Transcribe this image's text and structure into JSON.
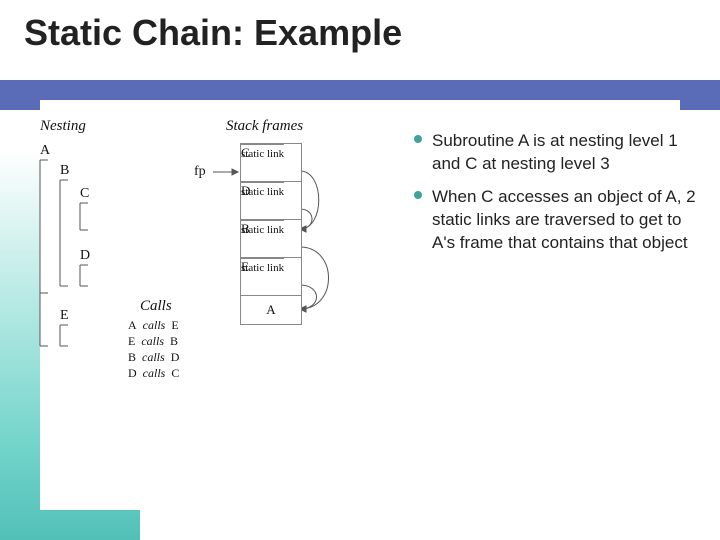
{
  "title": "Static Chain: Example",
  "bullets": [
    "Subroutine A is at nesting level 1 and C at nesting level 3",
    "When C accesses an object of A, 2 static links are traversed to get to A's frame that contains that object"
  ],
  "diagram": {
    "nesting_heading": "Nesting",
    "stack_heading": "Stack frames",
    "fp_label": "fp",
    "calls_heading": "Calls",
    "nesting_labels": {
      "A": "A",
      "B": "B",
      "C": "C",
      "D": "D",
      "E": "E"
    },
    "calls": [
      {
        "caller": "A",
        "verb": "calls",
        "callee": "E"
      },
      {
        "caller": "E",
        "verb": "calls",
        "callee": "B"
      },
      {
        "caller": "B",
        "verb": "calls",
        "callee": "D"
      },
      {
        "caller": "D",
        "verb": "calls",
        "callee": "C"
      }
    ],
    "stack": [
      {
        "name": "C",
        "link": "static link"
      },
      {
        "name": "D",
        "link": "static link"
      },
      {
        "name": "B",
        "link": "static link"
      },
      {
        "name": "E",
        "link": "static link"
      },
      {
        "name": "A",
        "link": null
      }
    ]
  }
}
